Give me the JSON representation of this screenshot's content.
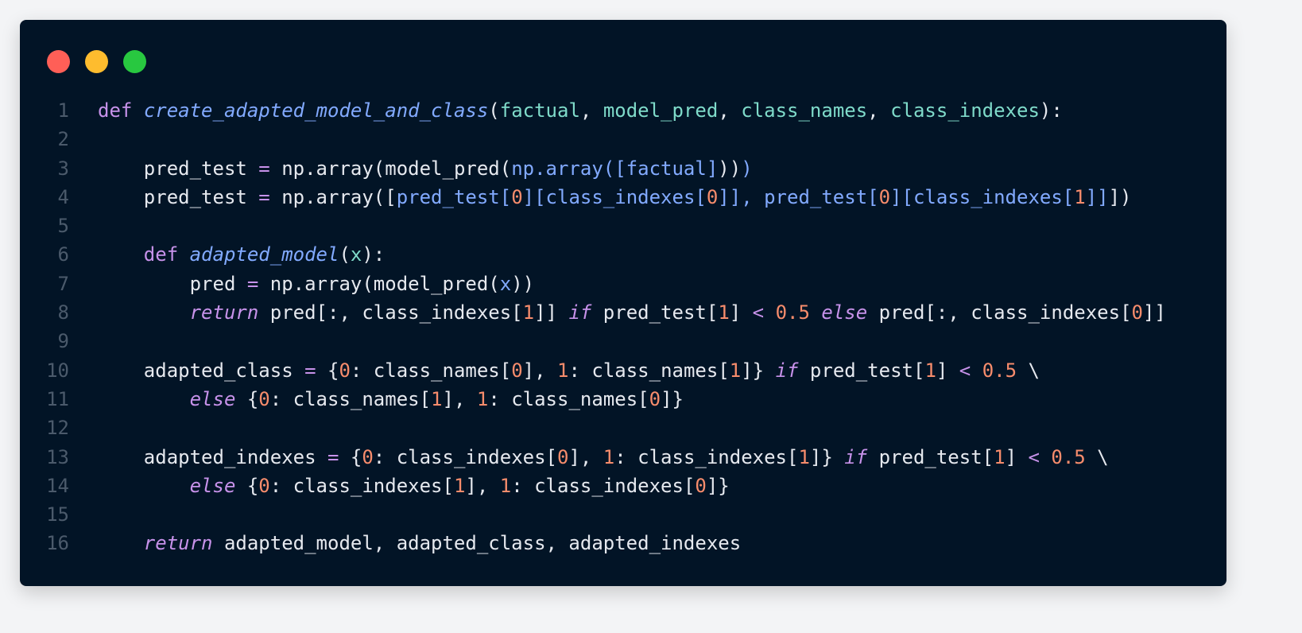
{
  "window": {
    "traffic_lights": {
      "close_color": "#ff5f57",
      "minimize_color": "#febc2e",
      "maximize_color": "#28c840"
    }
  },
  "colors": {
    "background": "#021426",
    "keyword": "#c792ea",
    "function": "#82aaff",
    "parameter": "#7fdbca",
    "number": "#f78c6c",
    "text": "#e6e9ef",
    "line_number": "#4b5a6b"
  },
  "code": {
    "lines": [
      {
        "n": "1",
        "tokens": [
          [
            "kw",
            "def"
          ],
          [
            "plain",
            " "
          ],
          [
            "fn",
            "create_adapted_model_and_class"
          ],
          [
            "plain",
            "("
          ],
          [
            "param",
            "factual"
          ],
          [
            "plain",
            ", "
          ],
          [
            "param",
            "model_pred"
          ],
          [
            "plain",
            ", "
          ],
          [
            "param",
            "class_names"
          ],
          [
            "plain",
            ", "
          ],
          [
            "param",
            "class_indexes"
          ],
          [
            "plain",
            "):"
          ]
        ]
      },
      {
        "n": "2",
        "tokens": []
      },
      {
        "n": "3",
        "tokens": [
          [
            "plain",
            "    pred_test "
          ],
          [
            "op",
            "="
          ],
          [
            "plain",
            " np.array(model_pred("
          ],
          [
            "blu",
            "np.array([factual]"
          ],
          [
            "plain",
            "))"
          ],
          [
            "blu",
            ")"
          ]
        ]
      },
      {
        "n": "4",
        "tokens": [
          [
            "plain",
            "    pred_test "
          ],
          [
            "op",
            "="
          ],
          [
            "plain",
            " np.array(["
          ],
          [
            "blu",
            "pred_test["
          ],
          [
            "num",
            "0"
          ],
          [
            "blu",
            "][class_indexes["
          ],
          [
            "num",
            "0"
          ],
          [
            "blu",
            "]], pred_test["
          ],
          [
            "num",
            "0"
          ],
          [
            "blu",
            "][class_indexes["
          ],
          [
            "num",
            "1"
          ],
          [
            "blu",
            "]]"
          ],
          [
            "plain",
            "])"
          ]
        ]
      },
      {
        "n": "5",
        "tokens": []
      },
      {
        "n": "6",
        "tokens": [
          [
            "plain",
            "    "
          ],
          [
            "kw",
            "def"
          ],
          [
            "plain",
            " "
          ],
          [
            "fn",
            "adapted_model"
          ],
          [
            "plain",
            "("
          ],
          [
            "param",
            "x"
          ],
          [
            "plain",
            "):"
          ]
        ]
      },
      {
        "n": "7",
        "tokens": [
          [
            "plain",
            "        pred "
          ],
          [
            "op",
            "="
          ],
          [
            "plain",
            " np.array(model_pred("
          ],
          [
            "blu",
            "x"
          ],
          [
            "plain",
            "))"
          ]
        ]
      },
      {
        "n": "8",
        "tokens": [
          [
            "plain",
            "        "
          ],
          [
            "kwi",
            "return"
          ],
          [
            "plain",
            " pred[:, class_indexes["
          ],
          [
            "num",
            "1"
          ],
          [
            "plain",
            "]] "
          ],
          [
            "kwi",
            "if"
          ],
          [
            "plain",
            " pred_test["
          ],
          [
            "num",
            "1"
          ],
          [
            "plain",
            "] "
          ],
          [
            "op",
            "<"
          ],
          [
            "plain",
            " "
          ],
          [
            "num",
            "0.5"
          ],
          [
            "plain",
            " "
          ],
          [
            "kwi",
            "else"
          ],
          [
            "plain",
            " pred[:, class_indexes["
          ],
          [
            "num",
            "0"
          ],
          [
            "plain",
            "]]"
          ]
        ]
      },
      {
        "n": "9",
        "tokens": []
      },
      {
        "n": "10",
        "tokens": [
          [
            "plain",
            "    adapted_class "
          ],
          [
            "op",
            "="
          ],
          [
            "plain",
            " {"
          ],
          [
            "num",
            "0"
          ],
          [
            "plain",
            ": class_names["
          ],
          [
            "num",
            "0"
          ],
          [
            "plain",
            "], "
          ],
          [
            "num",
            "1"
          ],
          [
            "plain",
            ": class_names["
          ],
          [
            "num",
            "1"
          ],
          [
            "plain",
            "]} "
          ],
          [
            "kwi",
            "if"
          ],
          [
            "plain",
            " pred_test["
          ],
          [
            "num",
            "1"
          ],
          [
            "plain",
            "] "
          ],
          [
            "op",
            "<"
          ],
          [
            "plain",
            " "
          ],
          [
            "num",
            "0.5"
          ],
          [
            "plain",
            " \\"
          ]
        ]
      },
      {
        "n": "11",
        "tokens": [
          [
            "plain",
            "        "
          ],
          [
            "kwi",
            "else"
          ],
          [
            "plain",
            " {"
          ],
          [
            "num",
            "0"
          ],
          [
            "plain",
            ": class_names["
          ],
          [
            "num",
            "1"
          ],
          [
            "plain",
            "], "
          ],
          [
            "num",
            "1"
          ],
          [
            "plain",
            ": class_names["
          ],
          [
            "num",
            "0"
          ],
          [
            "plain",
            "]}"
          ]
        ]
      },
      {
        "n": "12",
        "tokens": []
      },
      {
        "n": "13",
        "tokens": [
          [
            "plain",
            "    adapted_indexes "
          ],
          [
            "op",
            "="
          ],
          [
            "plain",
            " {"
          ],
          [
            "num",
            "0"
          ],
          [
            "plain",
            ": class_indexes["
          ],
          [
            "num",
            "0"
          ],
          [
            "plain",
            "], "
          ],
          [
            "num",
            "1"
          ],
          [
            "plain",
            ": class_indexes["
          ],
          [
            "num",
            "1"
          ],
          [
            "plain",
            "]} "
          ],
          [
            "kwi",
            "if"
          ],
          [
            "plain",
            " pred_test["
          ],
          [
            "num",
            "1"
          ],
          [
            "plain",
            "] "
          ],
          [
            "op",
            "<"
          ],
          [
            "plain",
            " "
          ],
          [
            "num",
            "0.5"
          ],
          [
            "plain",
            " \\"
          ]
        ]
      },
      {
        "n": "14",
        "tokens": [
          [
            "plain",
            "        "
          ],
          [
            "kwi",
            "else"
          ],
          [
            "plain",
            " {"
          ],
          [
            "num",
            "0"
          ],
          [
            "plain",
            ": class_indexes["
          ],
          [
            "num",
            "1"
          ],
          [
            "plain",
            "], "
          ],
          [
            "num",
            "1"
          ],
          [
            "plain",
            ": class_indexes["
          ],
          [
            "num",
            "0"
          ],
          [
            "plain",
            "]}"
          ]
        ]
      },
      {
        "n": "15",
        "tokens": []
      },
      {
        "n": "16",
        "tokens": [
          [
            "plain",
            "    "
          ],
          [
            "kwi",
            "return"
          ],
          [
            "plain",
            " adapted_model, adapted_class, adapted_indexes"
          ]
        ]
      }
    ]
  }
}
